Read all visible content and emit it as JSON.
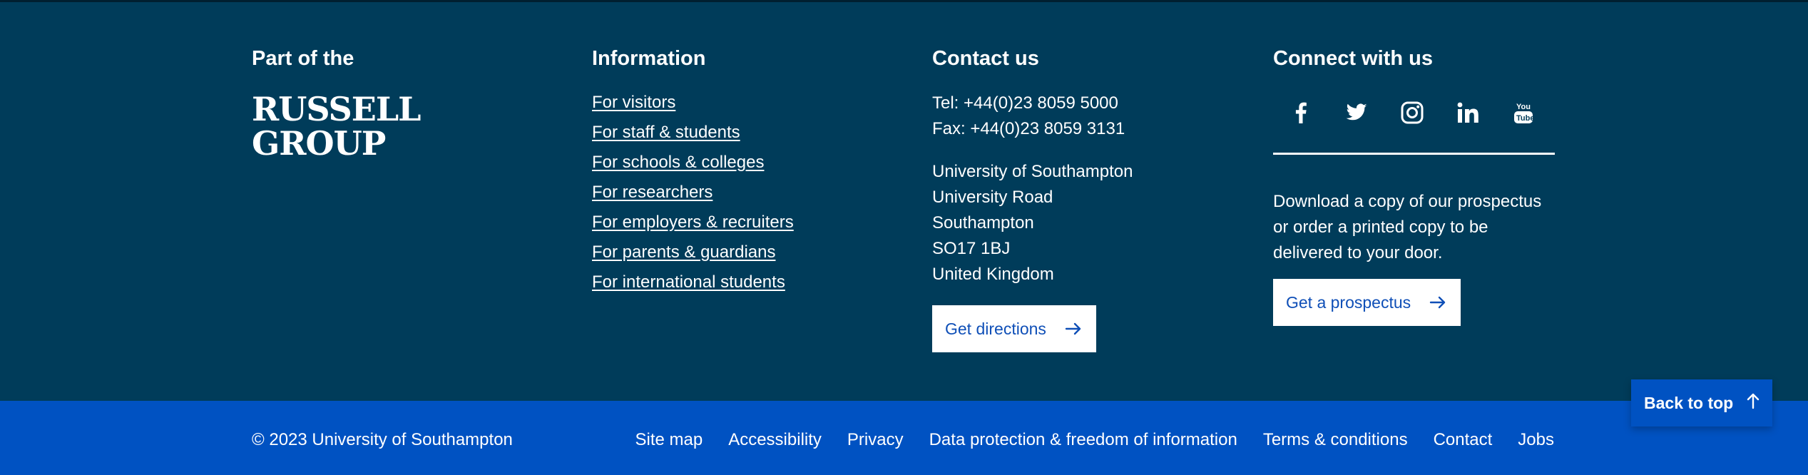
{
  "colors": {
    "main_background": "#003c5a",
    "bottom_bar_background": "#0052c2",
    "text": "#ffffff",
    "button_text": "#0f4fb7"
  },
  "partner": {
    "heading": "Part of the",
    "logo_line1": "RUSSELL",
    "logo_line2": "GROUP"
  },
  "information": {
    "heading": "Information",
    "links": [
      "For visitors",
      "For staff & students",
      "For schools & colleges",
      "For researchers",
      "For employers & recruiters",
      "For parents & guardians",
      "For international students"
    ]
  },
  "contact": {
    "heading": "Contact us",
    "tel": "Tel: +44(0)23 8059 5000",
    "fax": "Fax: +44(0)23 8059 3131",
    "address": [
      "University of Southampton",
      "University Road",
      "Southampton",
      "SO17 1BJ",
      "United Kingdom"
    ],
    "directions_label": "Get directions",
    "arrow_icon": "arrow-right-icon"
  },
  "connect": {
    "heading": "Connect with us",
    "social": [
      "facebook-icon",
      "twitter-icon",
      "instagram-icon",
      "linkedin-icon",
      "youtube-icon"
    ],
    "prospectus_text": "Download a copy of our prospectus or order a printed copy to be delivered to your door.",
    "prospectus_label": "Get a prospectus",
    "arrow_icon": "arrow-right-icon"
  },
  "bottom_bar": {
    "copyright": "© 2023 University of Southampton",
    "links": [
      "Site map",
      "Accessibility",
      "Privacy",
      "Data protection & freedom of information",
      "Terms & conditions",
      "Contact",
      "Jobs"
    ]
  },
  "back_to_top": {
    "label": "Back to top",
    "icon": "arrow-up-icon"
  }
}
